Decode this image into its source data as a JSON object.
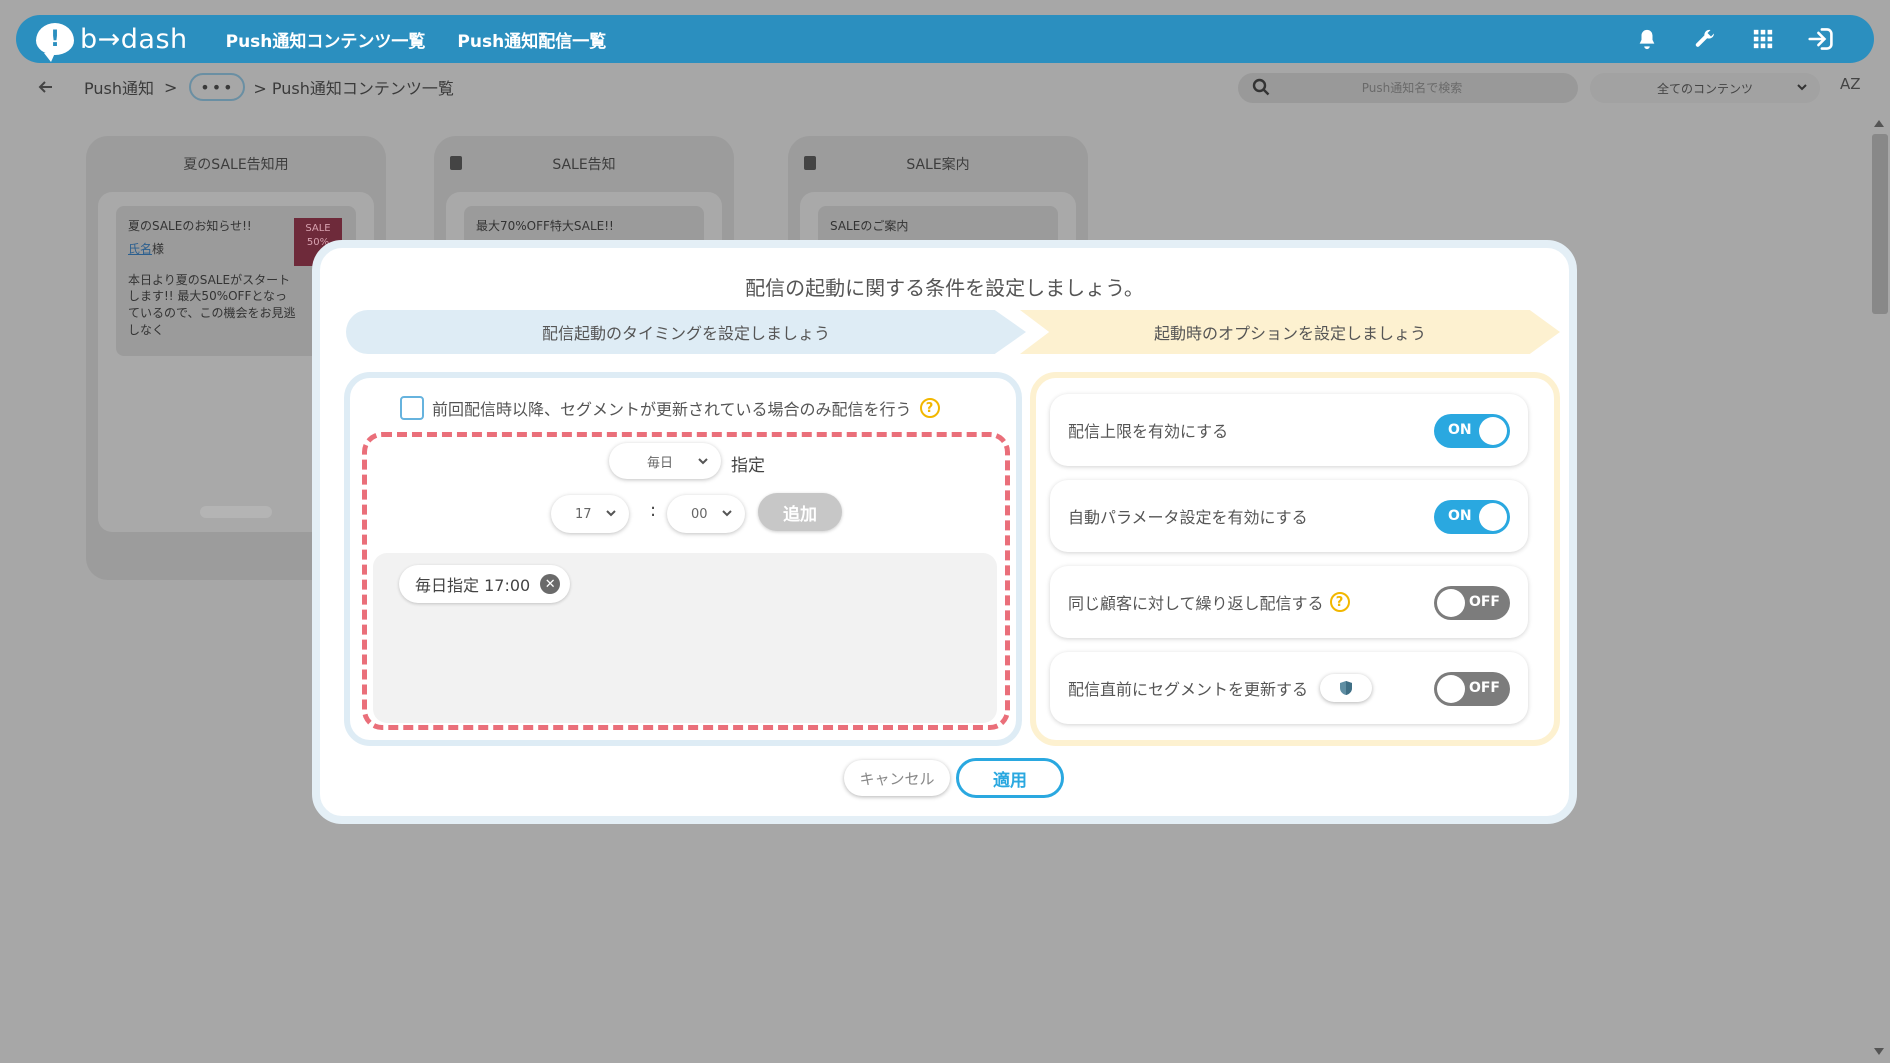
{
  "header": {
    "logo_mark": "!",
    "logo_text": "b→dash",
    "nav": [
      "Push通知コンテンツ一覧",
      "Push通知配信一覧"
    ],
    "icons": [
      "bell-icon",
      "wrench-icon",
      "grid-icon",
      "logout-icon"
    ]
  },
  "subbar": {
    "breadcrumb_root": "Push通知",
    "sep1": ">",
    "more": "•••",
    "current": "> Push通知コンテンツ一覧",
    "search_placeholder": "Push通知名で検索",
    "filter_value": "全てのコンテンツ",
    "sort_label": "AZ"
  },
  "cards": [
    {
      "title": "夏のSALE告知用",
      "message_title": "夏のSALEのお知らせ!!",
      "name_link": "氏名",
      "name_suffix": "様",
      "body": "本日より夏のSALEがスタートします!! 最大50%OFFとなっているので、この機会をお見逃しなく",
      "image_text": "SALE 50%"
    },
    {
      "title": "SALE告知",
      "message_title": "最大70%OFF特大SALE!!"
    },
    {
      "title": "SALE案内",
      "message_title": "SALEのご案内"
    }
  ],
  "modal": {
    "title": "配信の起動に関する条件を設定しましょう。",
    "step1": "配信起動のタイミングを設定しましょう",
    "step2": "起動時のオプションを設定しましょう",
    "segment_checkbox_label": "前回配信時以降、セグメントが更新されている場合のみ配信を行う",
    "help_mark": "?",
    "frequency_value": "毎日",
    "frequency_suffix": "指定",
    "hour_value": "17",
    "minute_value": "00",
    "colon": ":",
    "add_label": "追加",
    "schedules": [
      "毎日指定 17:00"
    ],
    "chip_remove": "✕",
    "options": [
      {
        "label": "配信上限を有効にする",
        "state": "ON",
        "on": true
      },
      {
        "label": "自動パラメータ設定を有効にする",
        "state": "ON",
        "on": true
      },
      {
        "label": "同じ顧客に対して繰り返し配信する",
        "state": "OFF",
        "on": false,
        "help": true
      },
      {
        "label": "配信直前にセグメントを更新する",
        "state": "OFF",
        "on": false,
        "shield": true
      }
    ],
    "cancel_label": "キャンセル",
    "apply_label": "適用"
  },
  "colors": {
    "header_blue": "#2b8fbf",
    "accent_blue": "#2aa8e0",
    "dashed_red": "#ea6f7a",
    "step_blue": "#deecf5",
    "step_yellow": "#fdf1d0",
    "help_yellow": "#f2b700"
  }
}
